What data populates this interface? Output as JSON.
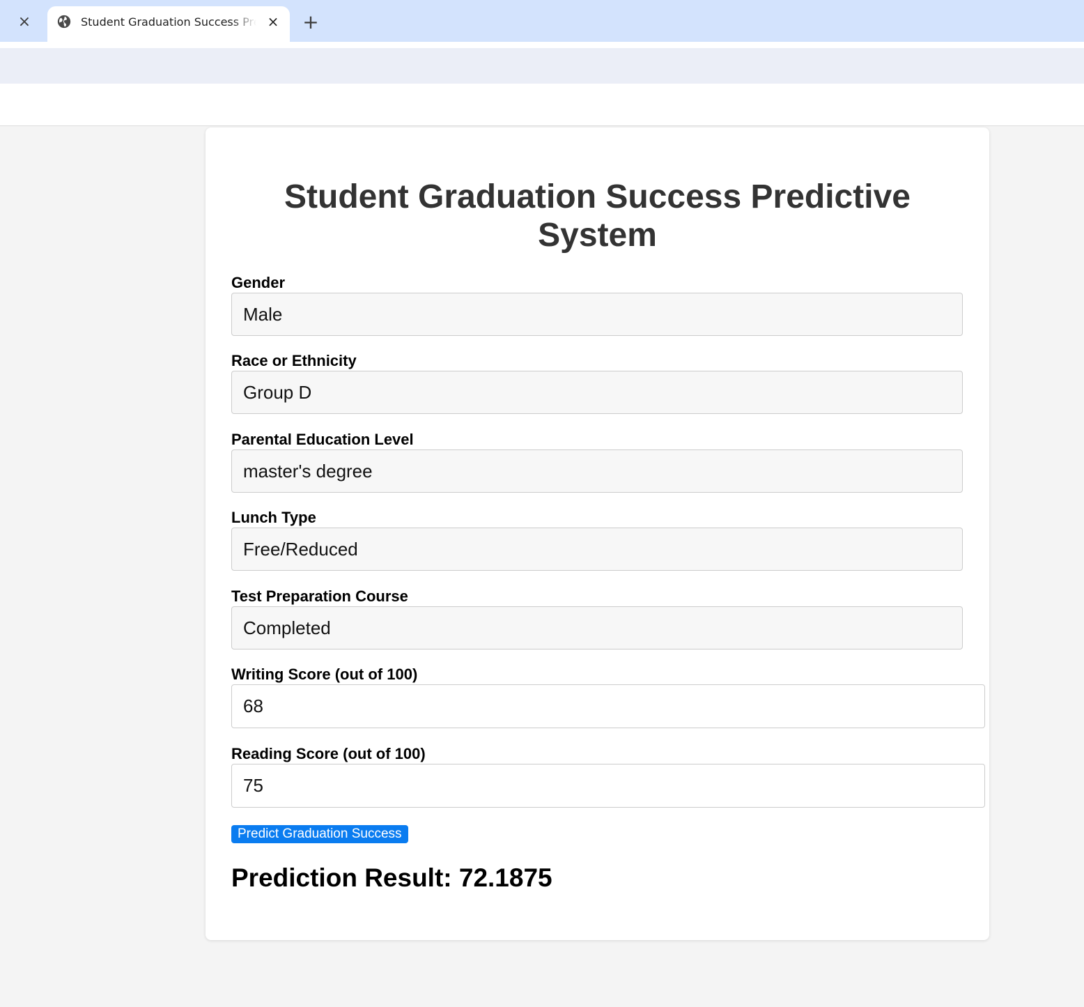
{
  "browser": {
    "tab_title": "Student Graduation Success Predictive System",
    "close_icon": "×",
    "new_tab_icon": "+"
  },
  "page": {
    "title": "Student Graduation Success Predictive System"
  },
  "form": {
    "gender": {
      "label": "Gender",
      "value": "Male"
    },
    "race": {
      "label": "Race or Ethnicity",
      "value": "Group D"
    },
    "parental_education": {
      "label": "Parental Education Level",
      "value": "master's degree"
    },
    "lunch": {
      "label": "Lunch Type",
      "value": "Free/Reduced"
    },
    "test_prep": {
      "label": "Test Preparation Course",
      "value": "Completed"
    },
    "writing_score": {
      "label": "Writing Score (out of 100)",
      "value": "68"
    },
    "reading_score": {
      "label": "Reading Score (out of 100)",
      "value": "75"
    },
    "submit_label": "Predict Graduation Success"
  },
  "result": {
    "text": "Prediction Result: 72.1875"
  },
  "colors": {
    "accent": "#0a7cf0",
    "tabbar": "#d3e3fd",
    "toolbar": "#ebeef7"
  }
}
